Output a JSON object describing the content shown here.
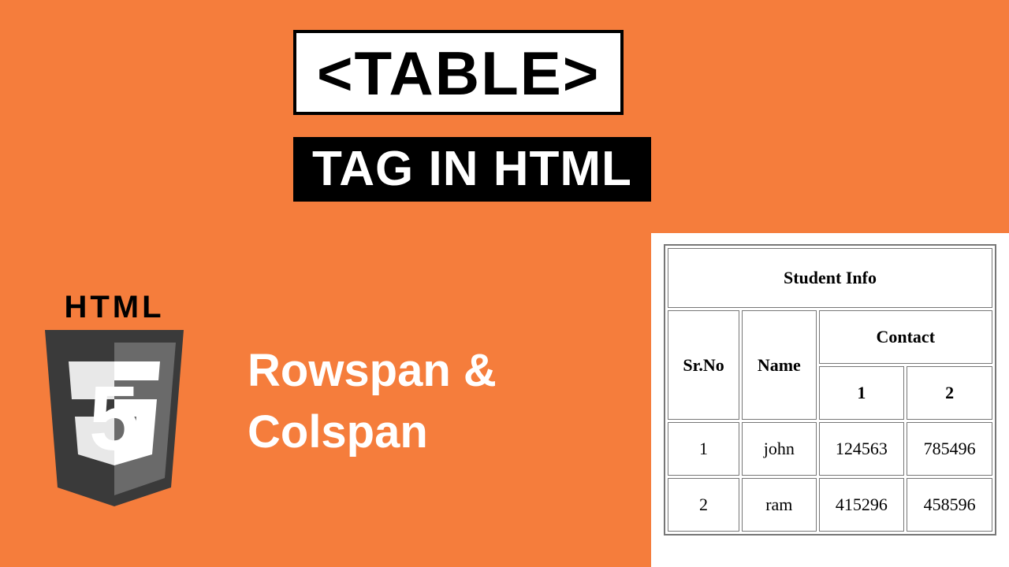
{
  "title": "<TABLE>",
  "subtitle": "TAG IN HTML",
  "subtext_line1": "Rowspan &",
  "subtext_line2": "Colspan",
  "logo": {
    "label": "HTML",
    "numeral": "5"
  },
  "example_table": {
    "caption": "Student Info",
    "headers": {
      "srno": "Sr.No",
      "name": "Name",
      "contact": "Contact",
      "contact_sub": [
        "1",
        "2"
      ]
    },
    "rows": [
      {
        "srno": "1",
        "name": "john",
        "c1": "124563",
        "c2": "785496"
      },
      {
        "srno": "2",
        "name": "ram",
        "c1": "415296",
        "c2": "458596"
      }
    ]
  },
  "colors": {
    "background": "#f57d3c",
    "title_bg": "#ffffff",
    "title_fg": "#000000",
    "subtitle_bg": "#000000",
    "subtitle_fg": "#ffffff"
  }
}
